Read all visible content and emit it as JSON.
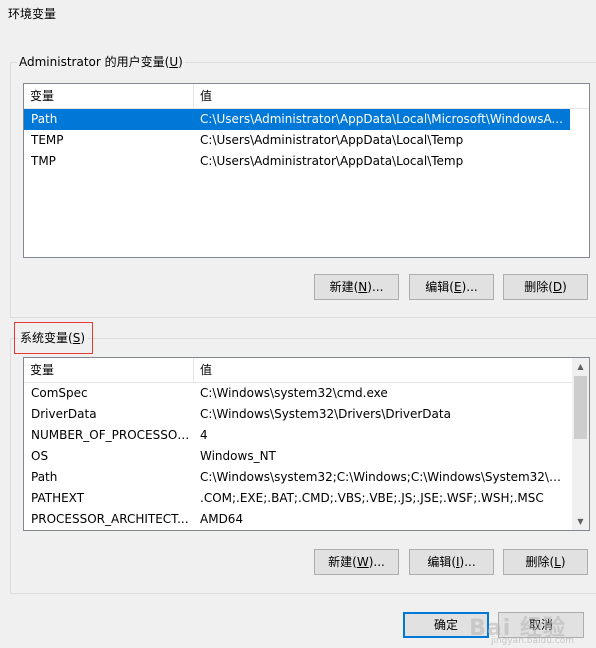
{
  "window": {
    "title": "环境变量"
  },
  "user_vars": {
    "group_label": "Administrator 的用户变量(",
    "group_key": "U",
    "group_label_end": ")",
    "columns": [
      "变量",
      "值"
    ],
    "rows": [
      {
        "name": "Path",
        "value": "C:\\Users\\Administrator\\AppData\\Local\\Microsoft\\WindowsA...",
        "selected": true
      },
      {
        "name": "TEMP",
        "value": "C:\\Users\\Administrator\\AppData\\Local\\Temp",
        "selected": false
      },
      {
        "name": "TMP",
        "value": "C:\\Users\\Administrator\\AppData\\Local\\Temp",
        "selected": false
      }
    ],
    "buttons": {
      "new": {
        "label": "新建(",
        "key": "N",
        "end": ")..."
      },
      "edit": {
        "label": "编辑(",
        "key": "E",
        "end": ")..."
      },
      "delete": {
        "label": "删除(",
        "key": "D",
        "end": ")"
      }
    }
  },
  "system_vars": {
    "group_label": "系统变量(",
    "group_key": "S",
    "group_label_end": ")",
    "columns": [
      "变量",
      "值"
    ],
    "rows": [
      {
        "name": "ComSpec",
        "value": "C:\\Windows\\system32\\cmd.exe"
      },
      {
        "name": "DriverData",
        "value": "C:\\Windows\\System32\\Drivers\\DriverData"
      },
      {
        "name": "NUMBER_OF_PROCESSORS",
        "value": "4"
      },
      {
        "name": "OS",
        "value": "Windows_NT"
      },
      {
        "name": "Path",
        "value": "C:\\Windows\\system32;C:\\Windows;C:\\Windows\\System32\\Wb..."
      },
      {
        "name": "PATHEXT",
        "value": ".COM;.EXE;.BAT;.CMD;.VBS;.VBE;.JS;.JSE;.WSF;.WSH;.MSC"
      },
      {
        "name": "PROCESSOR_ARCHITECT...",
        "value": "AMD64"
      }
    ],
    "buttons": {
      "new": {
        "label": "新建(",
        "key": "W",
        "end": ")..."
      },
      "edit": {
        "label": "编辑(",
        "key": "I",
        "end": ")..."
      },
      "delete": {
        "label": "删除(",
        "key": "L",
        "end": ")"
      }
    }
  },
  "dialog_buttons": {
    "ok": "确定",
    "cancel": "取消"
  },
  "watermark": {
    "main": "Bai 经验",
    "sub": "jingyan.baidu.com"
  },
  "colors": {
    "selection": "#0078d7",
    "highlight": "#e53935"
  }
}
